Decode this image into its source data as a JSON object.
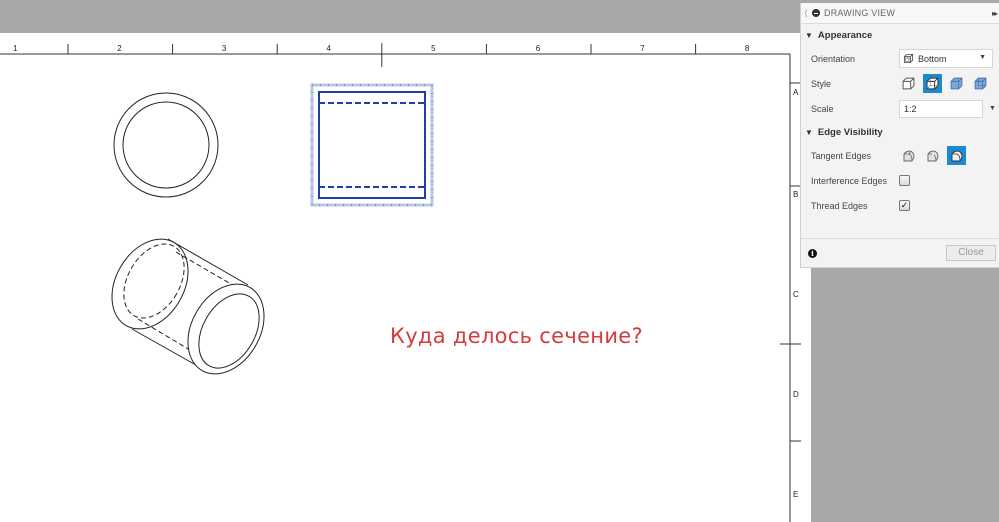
{
  "sheet": {
    "column_labels": [
      "1",
      "2",
      "3",
      "4",
      "5",
      "6",
      "7",
      "8"
    ],
    "row_labels": [
      "A",
      "B",
      "C",
      "D",
      "E"
    ],
    "note_text": "Куда делось сечение?",
    "note_color": "#d23c3c",
    "selection_color": "#1f3fa8",
    "views": [
      {
        "name": "top-view",
        "type": "circle-ring"
      },
      {
        "name": "bottom-view",
        "type": "rectangle-hidden-lines",
        "selected": true
      },
      {
        "name": "isometric-view",
        "type": "cylinder-iso"
      }
    ]
  },
  "panel": {
    "title": "DRAWING VIEW",
    "appearance": {
      "section_label": "Appearance",
      "orientation_label": "Orientation",
      "orientation_value": "Bottom",
      "style_label": "Style",
      "style_options": [
        "visible-edges-icon",
        "visible-and-hidden-edges-icon",
        "shaded-icon",
        "shaded-hidden-edges-icon"
      ],
      "style_selected_index": 1,
      "scale_label": "Scale",
      "scale_value": "1:2"
    },
    "edge_visibility": {
      "section_label": "Edge Visibility",
      "tangent_label": "Tangent Edges",
      "tangent_options": [
        "full-length-icon",
        "shortened-icon",
        "off-icon"
      ],
      "tangent_selected_index": 2,
      "interference_label": "Interference Edges",
      "interference_checked": false,
      "thread_label": "Thread Edges",
      "thread_checked": true,
      "check_mark": "✓"
    },
    "footer": {
      "info_glyph": "i",
      "close_label": "Close"
    },
    "accent_color": "#1a8bd0"
  }
}
